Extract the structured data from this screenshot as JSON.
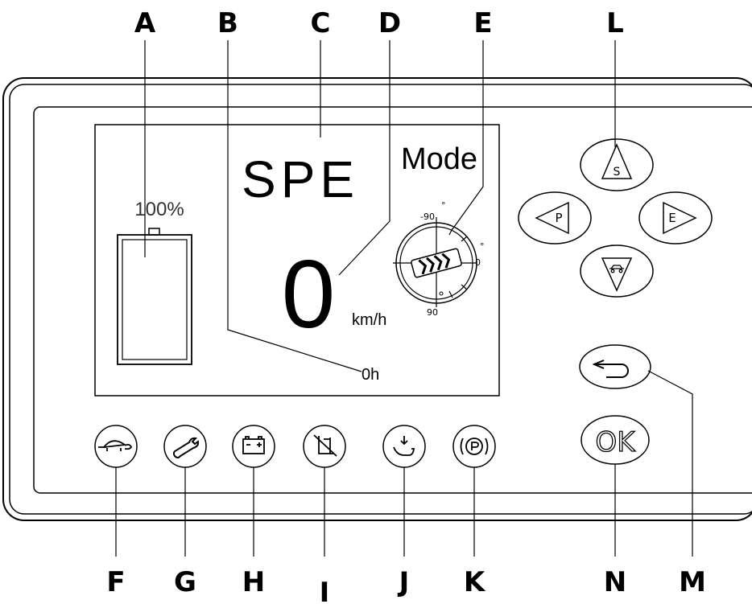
{
  "callouts": {
    "a": "A",
    "b": "B",
    "c": "C",
    "d": "D",
    "e": "E",
    "l": "L",
    "f": "F",
    "g": "G",
    "h": "H",
    "i": "I",
    "j": "J",
    "k": "K",
    "n": "N",
    "m": "M"
  },
  "display": {
    "battery_percent": "100%",
    "mode_code": "SPE",
    "mode_label": "Mode",
    "speed_value": "0",
    "speed_unit": "km/h",
    "hours": "0h",
    "angle_neg": "-90",
    "angle_zero": "0",
    "angle_pos": "90",
    "degree": "°"
  },
  "nav_buttons": {
    "up": "S",
    "left": "P",
    "right": "E",
    "ok": "OK"
  },
  "icons": {
    "f": "turtle-icon",
    "g": "wrench-icon",
    "h": "battery-charge-icon",
    "i": "seat-belt-forbidden-icon",
    "j": "seat-icon",
    "k": "parking-brake-icon",
    "down": "vehicle-icon",
    "back": "back-arrow-icon"
  }
}
